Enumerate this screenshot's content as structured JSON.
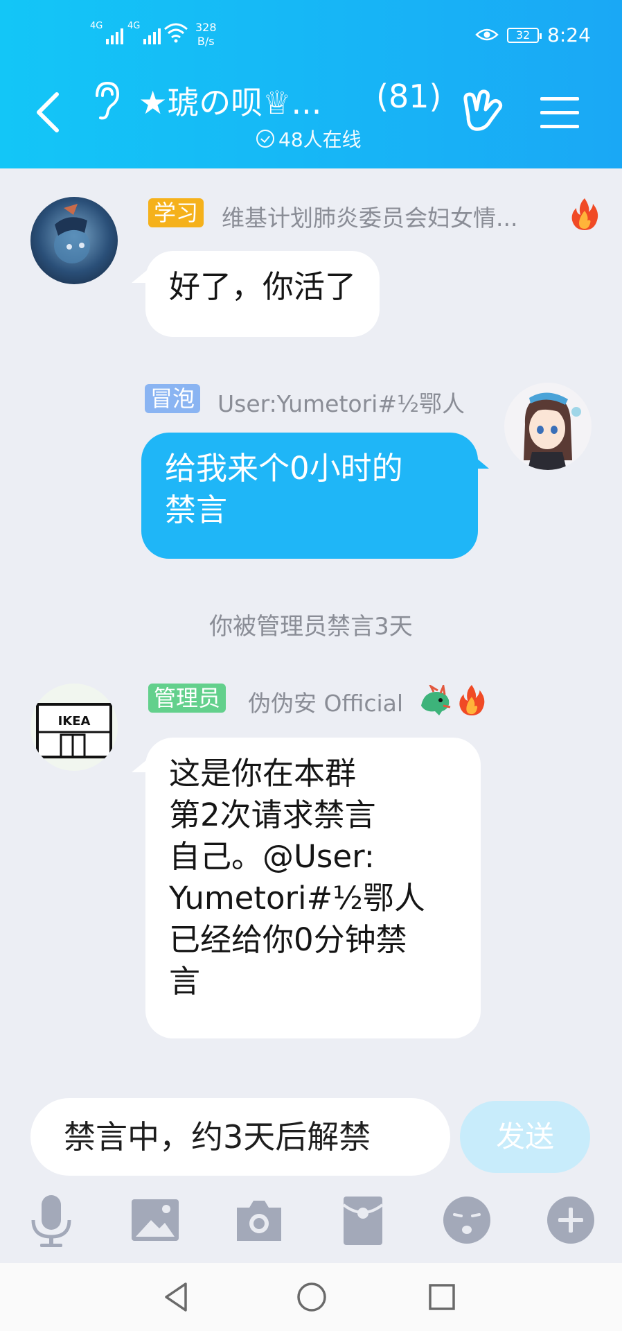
{
  "status_bar": {
    "net1": "4G",
    "net2": "4G",
    "speed_value": "328",
    "speed_unit": "B/s",
    "battery": "32",
    "time": "8:24"
  },
  "header": {
    "title": "★琥の呗♕...",
    "member_count": "(81)",
    "online": "48人在线"
  },
  "messages": [
    {
      "tag": "学习",
      "tag_color": "#f5b11b",
      "sender": "维基计划肺炎委员会妇女情...",
      "text": "好了，你活了"
    },
    {
      "tag": "冒泡",
      "tag_color": "#8ab4f2",
      "sender": "User:Yumetori#½鄂人",
      "text_lines": [
        "给我来个0小时的",
        "禁言"
      ]
    },
    {
      "tag": "管理员",
      "tag_color": "#63d08c",
      "sender": "伪伪安 Official",
      "text_lines": [
        "这是你在本群",
        "第2次请求禁言",
        "自己。@User:",
        "Yumetori#½鄂人",
        "已经给你0分钟禁",
        "言"
      ],
      "avatar_logo": "IKEA"
    }
  ],
  "system_message": "你被管理员禁言3天",
  "input": {
    "text": "禁言中，约3天后解禁",
    "send": "发送"
  },
  "toolbar": [
    "microphone-icon",
    "image-icon",
    "camera-icon",
    "red-packet-icon",
    "emoji-icon",
    "plus-icon"
  ],
  "colors": {
    "header": "#1aa8f5",
    "bubble_blue": "#1fb6f7",
    "background": "#eceef4"
  }
}
